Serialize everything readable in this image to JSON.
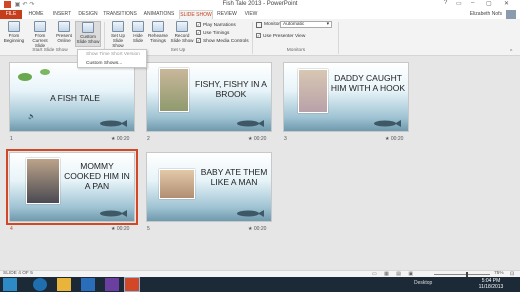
{
  "window": {
    "title": "Fish Tale 2013 - PowerPoint",
    "controls": [
      "?",
      "▭",
      "–",
      "▢",
      "✕"
    ]
  },
  "tabs": [
    {
      "label": "FILE",
      "kind": "file"
    },
    {
      "label": "HOME"
    },
    {
      "label": "INSERT"
    },
    {
      "label": "DESIGN"
    },
    {
      "label": "TRANSITIONS"
    },
    {
      "label": "ANIMATIONS"
    },
    {
      "label": "SLIDE SHOW",
      "kind": "active"
    },
    {
      "label": "REVIEW"
    },
    {
      "label": "VIEW"
    }
  ],
  "user": "Elizabeth Nofs",
  "ribbon": {
    "start": {
      "from_beginning": "From Beginning",
      "from_current": "From Current Slide",
      "present_online": "Present Online",
      "custom_show": "Custom Slide Show",
      "group": "Start Slide Show"
    },
    "setup": {
      "set_up": "Set Up Slide Show",
      "hide": "Hide Slide",
      "rehearse": "Rehearse Timings",
      "record": "Record Slide Show",
      "play_narrations": "Play Narrations",
      "use_timings": "Use Timings",
      "show_media": "Show Media Controls",
      "group": "Set Up"
    },
    "monitors": {
      "monitor_label": "Monitor:",
      "monitor_value": "Automatic",
      "presenter_view": "Use Presenter View",
      "group": "Monitors"
    }
  },
  "dropdown": {
    "item1": "Show Time Short Version",
    "item2": "Custom Shows..."
  },
  "slides": [
    {
      "num": "1",
      "title": "A FISH TALE",
      "time": "00:20"
    },
    {
      "num": "2",
      "title": "FISHY, FISHY IN A BROOK",
      "time": "00:20"
    },
    {
      "num": "3",
      "title": "DADDY CAUGHT HIM WITH A HOOK",
      "time": "00:20"
    },
    {
      "num": "4",
      "title": "MOMMY COOKED HIM IN A PAN",
      "time": "00:20"
    },
    {
      "num": "5",
      "title": "BABY ATE THEM LIKE A MAN",
      "time": "00:20"
    }
  ],
  "status": {
    "slide": "SLIDE 4 OF 5",
    "zoom": "75%"
  },
  "taskbar": {
    "desktop": "Desktop",
    "time": "5:04 PM",
    "date": "11/18/2013"
  }
}
